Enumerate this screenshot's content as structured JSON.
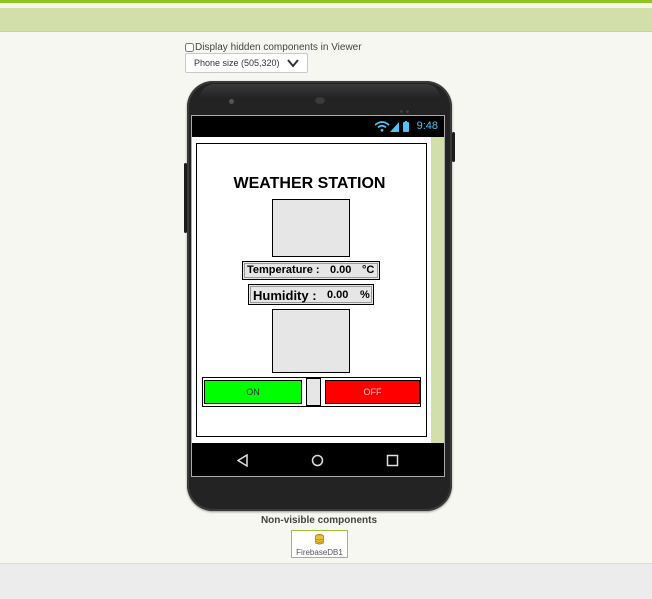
{
  "viewer": {
    "hidden_components_label": "Display hidden components in Viewer",
    "hidden_components_checked": false,
    "phone_size_selected": "Phone size (505,320)"
  },
  "status_bar": {
    "time": "9:48"
  },
  "app": {
    "title": "WEATHER STATION",
    "temperature": {
      "label": "Temperature :",
      "value": "0.00",
      "unit": "°C"
    },
    "humidity": {
      "label": "Humidity :",
      "value": "0.00",
      "unit": "%"
    },
    "buttons": {
      "on": {
        "label": "ON",
        "color": "#00ff00"
      },
      "off": {
        "label": "OFF",
        "color": "#ff0000"
      }
    }
  },
  "non_visible": {
    "heading": "Non-visible components",
    "items": [
      {
        "label": "FirebaseDB1",
        "icon": "database-icon"
      }
    ]
  },
  "colors": {
    "accent_green": "#8fc31f",
    "band": "#d2dfa8",
    "status_blue": "#4fc3f7"
  }
}
